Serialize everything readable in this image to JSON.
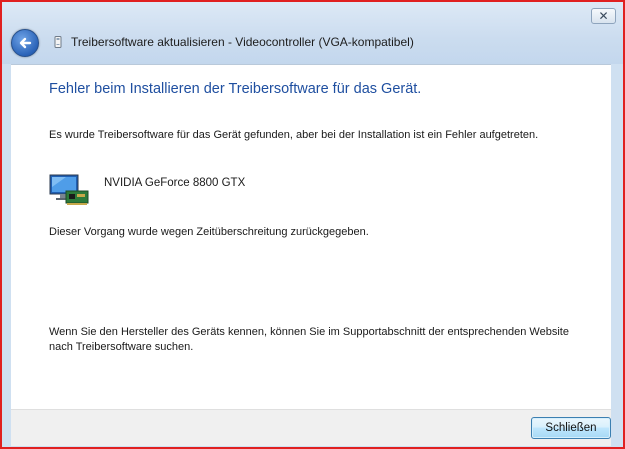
{
  "window": {
    "title": "Treibersoftware aktualisieren - Videocontroller (VGA-kompatibel)",
    "close_glyph": "✕"
  },
  "content": {
    "heading": "Fehler beim Installieren der Treibersoftware für das Gerät.",
    "message": "Es wurde Treibersoftware für das Gerät gefunden, aber bei der Installation ist ein Fehler aufgetreten.",
    "device_name": "NVIDIA GeForce 8800 GTX",
    "error_detail": "Dieser Vorgang wurde wegen Zeitüberschreitung zurückgegeben.",
    "hint": "Wenn Sie den Hersteller des Geräts kennen, können Sie im Supportabschnitt der entsprechenden Website nach Treibersoftware suchen."
  },
  "footer": {
    "close_label": "Schließen"
  },
  "icons": {
    "back": "back-arrow-icon",
    "title": "driver-icon",
    "device": "display-adapter-icon"
  },
  "colors": {
    "heading": "#1f4fa0",
    "frame": "#e02020",
    "button_border": "#3c7fb1"
  }
}
